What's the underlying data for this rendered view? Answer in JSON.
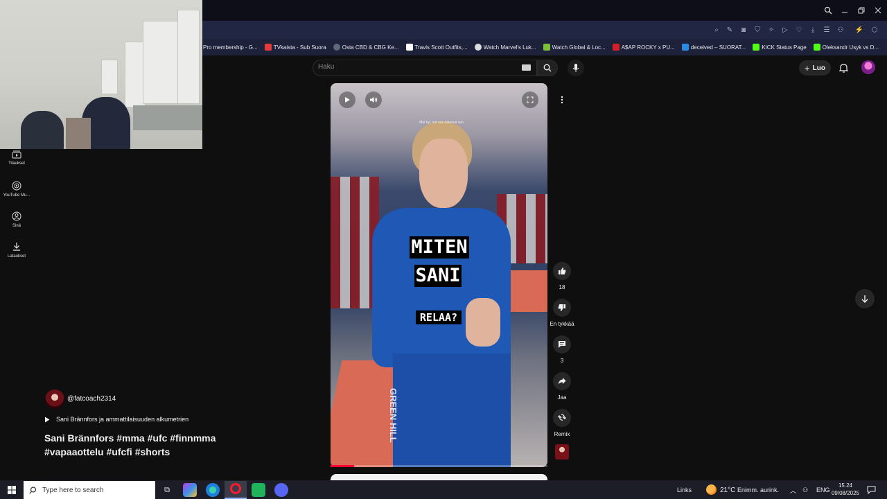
{
  "browser": {
    "bookmarks": [
      {
        "label": "Pro membership - G...",
        "color": "#1d213a"
      },
      {
        "label": "TVkaista - Sub Suora",
        "color": "#e23b3b"
      },
      {
        "label": "Osta CBD & CBG Ke...",
        "color": "#5e6a78"
      },
      {
        "label": "Travis Scott Outfits,...",
        "color": "#ffffff"
      },
      {
        "label": "Watch Marvel's Luk...",
        "color": "#dddddd"
      },
      {
        "label": "Watch Global & Loc...",
        "color": "#7cbd3a"
      },
      {
        "label": "A$AP ROCKY x PU...",
        "color": "#d4202a"
      },
      {
        "label": "deceived – SUORAT...",
        "color": "#2b8be0"
      },
      {
        "label": "KICK Status Page",
        "color": "#53fc18"
      },
      {
        "label": "Oleksandr Usyk vs D...",
        "color": "#53fc18"
      }
    ]
  },
  "youtube": {
    "search_placeholder": "Haku",
    "create_label": "Luo",
    "sidebar": [
      {
        "label": "Tilaukset",
        "icon": "subscriptions-icon"
      },
      {
        "label": "YouTube Mu...",
        "icon": "youtube-music-icon"
      },
      {
        "label": "Sinä",
        "icon": "you-icon"
      },
      {
        "label": "Lataukset",
        "icon": "downloads-icon"
      }
    ],
    "video": {
      "caption_line1": "MITEN",
      "caption_line2": "SANI",
      "caption_line3": "RELAA?",
      "subtitle_small": "Mut kyl, mä oon kokenut sen",
      "shirt_brand": "GREEN HILL",
      "progress_fraction": 0.11
    },
    "actions": {
      "like_count": "18",
      "dislike_label": "En tykkää",
      "comment_count": "3",
      "share_label": "Jaa",
      "remix_label": "Remix"
    },
    "channel": "@fatcoach2314",
    "playlist": "Sani Brännfors ja ammattilaisuuden alkumetrien",
    "title": "Sani Brännfors #mma #ufc #finnmma #vapaaottelu #ufcfi #shorts"
  },
  "taskbar": {
    "search_placeholder": "Type here to search",
    "links_label": "Links",
    "weather_temp": "21°C",
    "weather_text": "Enimm. aurink.",
    "language": "ENG",
    "time": "15.24",
    "date": "09/08/2025"
  }
}
